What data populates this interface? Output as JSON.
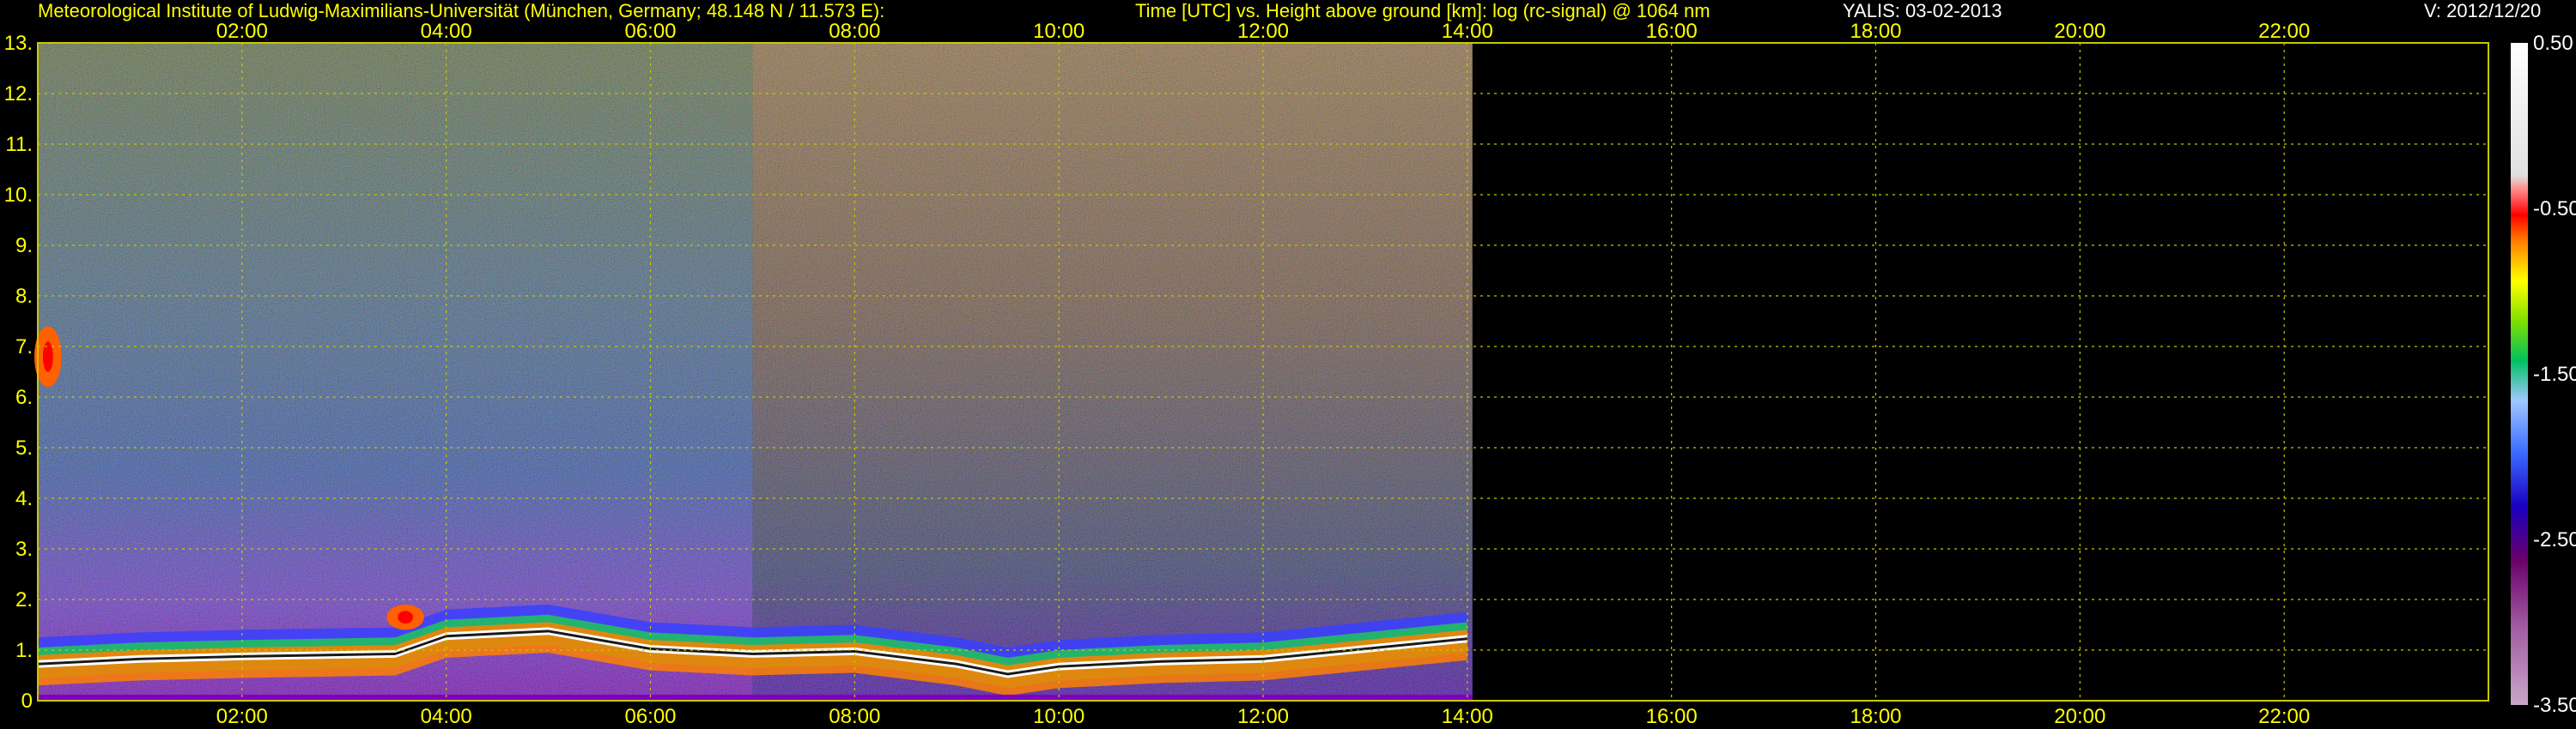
{
  "header": {
    "institute": "Meteorological Institute of Ludwig-Maximilians-Universität (München, Germany; 48.148 N / 11.573 E):",
    "description": "Time [UTC] vs. Height above ground [km]: log (rc-signal) @ 1064 nm",
    "instrument_date": "YALIS: 03-02-2013",
    "version": "V: 2012/12/20"
  },
  "colors": {
    "background": "#000000",
    "axis_text": "#ffff00",
    "grid": "#c8c800",
    "colorbar_text": "#ffffff"
  },
  "chart_data": {
    "type": "heatmap",
    "x_range_hours": [
      0,
      24
    ],
    "y_range_km": [
      0,
      13
    ],
    "data_end_hour": 14.05,
    "grid": true,
    "x_ticks": [
      "02:00",
      "04:00",
      "06:00",
      "08:00",
      "10:00",
      "12:00",
      "14:00",
      "16:00",
      "18:00",
      "20:00",
      "22:00"
    ],
    "y_ticks": [
      "0",
      "1.",
      "2.",
      "3.",
      "4.",
      "5.",
      "6.",
      "7.",
      "8.",
      "9.",
      "10.",
      "11.",
      "12.",
      "13."
    ],
    "colorbar": {
      "range": [
        -3.5,
        0.5
      ],
      "labels": [
        "0.50",
        "-0.50",
        "-1.50",
        "-2.50",
        "-3.50"
      ]
    },
    "features": [
      {
        "name": "boundary layer top",
        "points": [
          [
            0.0,
            0.8
          ],
          [
            1.0,
            0.9
          ],
          [
            2.0,
            0.95
          ],
          [
            3.5,
            1.0
          ],
          [
            4.0,
            1.35
          ],
          [
            5.0,
            1.45
          ],
          [
            6.0,
            1.1
          ],
          [
            7.0,
            1.0
          ],
          [
            8.0,
            1.05
          ],
          [
            9.0,
            0.8
          ],
          [
            9.5,
            0.6
          ],
          [
            10.0,
            0.75
          ],
          [
            11.0,
            0.85
          ],
          [
            12.0,
            0.9
          ],
          [
            13.0,
            1.1
          ],
          [
            14.0,
            1.3
          ]
        ]
      },
      {
        "name": "cloud",
        "x": [
          0.0,
          0.2
        ],
        "y": [
          6.2,
          7.4
        ]
      },
      {
        "name": "cloud",
        "x": [
          3.45,
          3.75
        ],
        "y": [
          1.4,
          1.9
        ]
      }
    ]
  }
}
